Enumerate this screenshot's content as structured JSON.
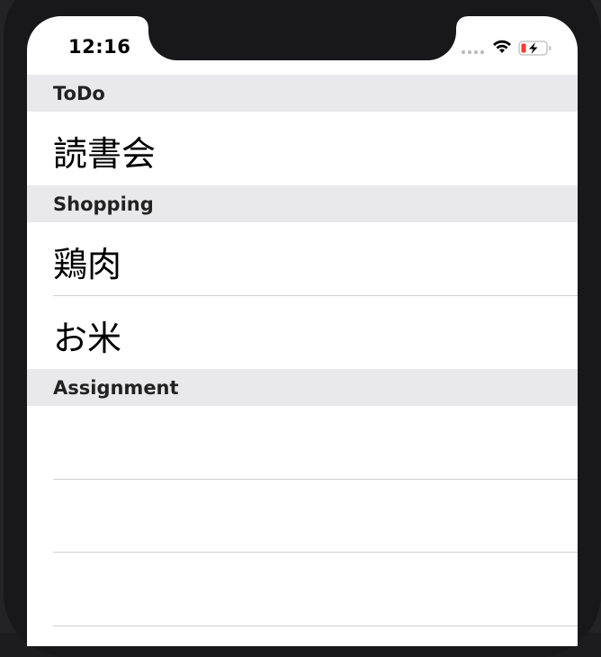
{
  "status_bar": {
    "time": "12:16",
    "signal_icon": "cellular-dots-icon",
    "wifi_icon": "wifi-icon",
    "battery_icon": "battery-charging-icon",
    "battery_color": "#ff3b30"
  },
  "sections": [
    {
      "title": "ToDo",
      "rows": [
        "読書会"
      ]
    },
    {
      "title": "Shopping",
      "rows": [
        "鶏肉",
        "お米"
      ]
    },
    {
      "title": "Assignment",
      "rows": [
        "",
        "",
        ""
      ]
    }
  ],
  "colors": {
    "section_header_bg": "#e9e9eb",
    "separator": "#d0d0d4",
    "bezel": "#18181a"
  }
}
